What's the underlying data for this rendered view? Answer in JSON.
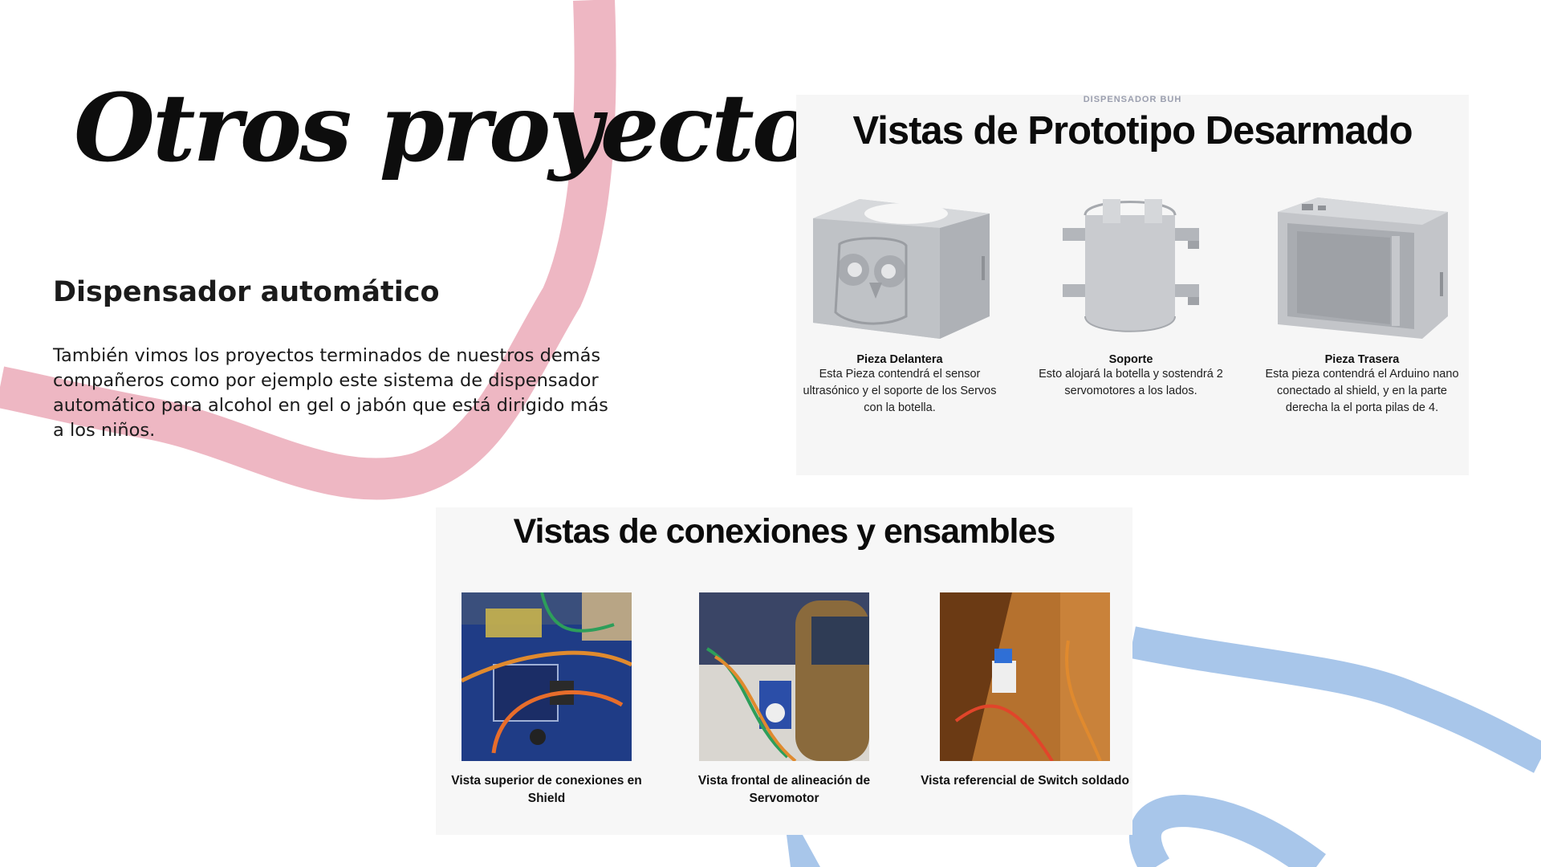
{
  "slide": {
    "title": "Otros proyectos",
    "subtitle": "Dispensador automático",
    "body": "También vimos los proyectos terminados de nuestros demás compañeros como por ejemplo este sistema de dispensador automático para alcohol en gel o jabón que está dirigido más a los niños."
  },
  "prototype_panel": {
    "kicker": "DISPENSADOR BUH",
    "title": "Vistas de Prototipo Desarmado",
    "pieces": [
      {
        "name": "Pieza Delantera",
        "description": "Esta Pieza contendrá el sensor ultrasónico y el soporte de los Servos con la botella.",
        "icon": "front-piece-owl-box-icon"
      },
      {
        "name": "Soporte",
        "description": "Esto alojará la botella y sostendrá 2 servomotores a los lados.",
        "icon": "cylinder-support-icon"
      },
      {
        "name": "Pieza Trasera",
        "description": "Esta pieza contendrá el Arduino nano conectado al shield, y en la parte derecha la el porta pilas de 4.",
        "icon": "open-back-box-icon"
      }
    ]
  },
  "connections_panel": {
    "title": "Vistas de conexiones y ensambles",
    "photos": [
      {
        "caption": "Vista superior de conexiones en Shield"
      },
      {
        "caption": "Vista frontal de alineación de Servomotor"
      },
      {
        "caption": "Vista referencial de Switch soldado"
      }
    ]
  },
  "colors": {
    "pink_ribbon": "#eeb7c3",
    "blue_ribbon": "#a8c6ea",
    "title_text": "#0d0d0d",
    "model_gray": "#b9bcc1"
  }
}
